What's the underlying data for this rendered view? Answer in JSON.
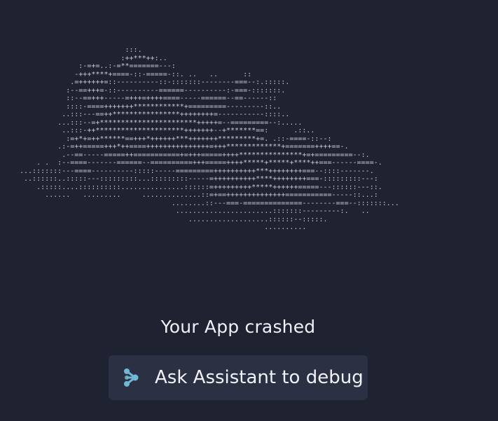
{
  "crash_art": {
    "icon": "ascii-cloud-art",
    "lines": [
      "                         :::.",
      "                        :++***++:..",
      "              :-=+=..:-=**=======---:",
      "             -+++****+====-::-=====-::. ..   ..      ::",
      "            .=++++++=::----------::-:::::::--------===--:.:::::.",
      "           :--==+++=-::----------======----------:-===-:::::::.",
      "           ::--==+++-----=+++=++++====-----======--==------::",
      "           ::::-====+++++++************+=========---------::..",
      "          ..:::---==++****************++++++++=-----------::::..",
      "         ...:::--=+***********************+++++=--=========--:.....",
      "          ..:::-++*********************+++++++--+*******==:      .::..",
      "           :=+*+=++******==+++*++++++***+++++++*********+=. .::-====-::--:",
      "         .:-=++=====+++*++====+++++++++++++++=+++*************+=======++++==-.",
      "          .--==-----=====++===========+=+++=====++++***************+=+=========--:.",
      "    . .  :--====-------======--==========+++=====++++*****+*****+****++===------====-.",
      "...:::::::---====----------:::::-----=========++++++++++***++++++++===--::::-------.",
      " ..::::::..:::::---:::::::::...:::::::::-----=++++++++++****++++++++===-:::::::::---:",
      "    .:::::....::::::::::...............::::::=+++++++++*****++++++=====---::::::---::.",
      "      ......   .........     ..............::=+==++++++++++++++===========-----::...:",
      "                                    ........::---===-==============--------===--:::::::...",
      "                                     .......................:::::::---------:.   ..",
      "                                        ...................::::::--:::::.",
      "                                                          .........."
    ]
  },
  "crash": {
    "message": "Your App crashed"
  },
  "actions": {
    "debug_button": {
      "label": "Ask Assistant to debug",
      "icon": "assistant-icon",
      "icon_color": "#6fb9d6"
    }
  },
  "colors": {
    "background": "#1e2231",
    "button_background": "#2b3042",
    "text": "#f1f2f7"
  }
}
